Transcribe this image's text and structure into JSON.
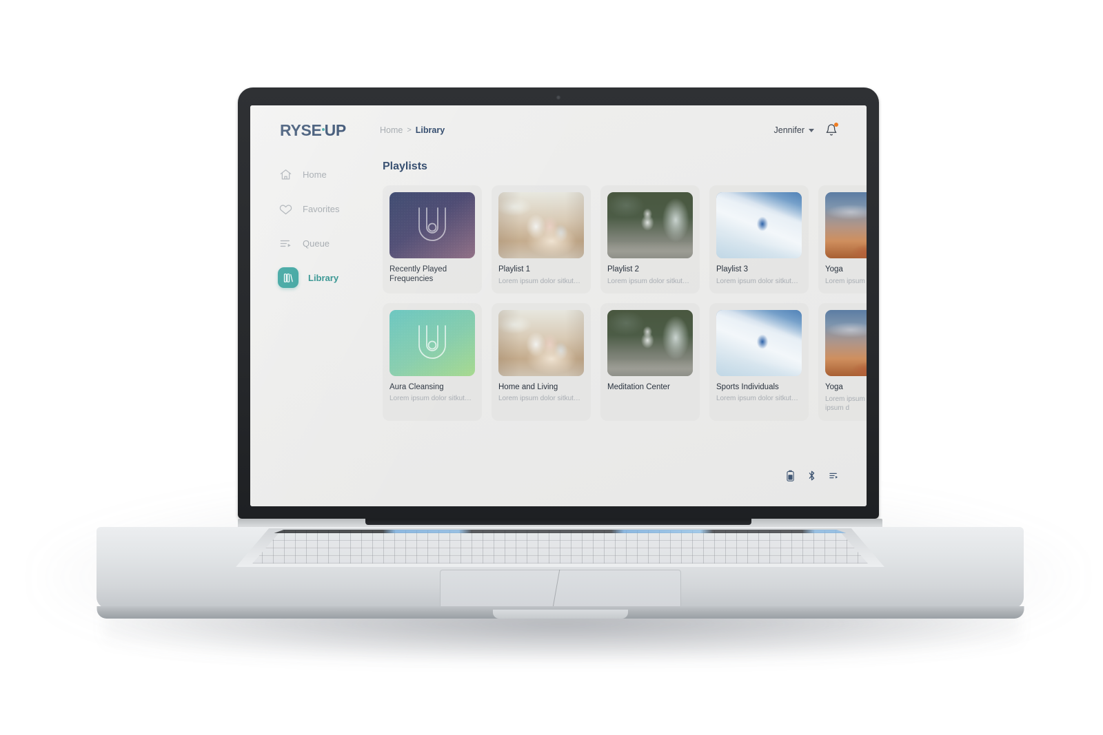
{
  "app": {
    "logo_text": "RYSEUP",
    "logo_primary": "RYSE",
    "logo_secondary": "UP",
    "accent_color": "#2b9c97",
    "brand_navy": "#1f3a5f",
    "badge_color": "#f07d22"
  },
  "breadcrumb": {
    "home": "Home",
    "separator": ">",
    "current": "Library"
  },
  "user": {
    "name": "Jennifer",
    "caret_icon": "chevron-down-icon",
    "bell_icon": "bell-icon",
    "has_notification": true
  },
  "sidebar": {
    "items": [
      {
        "label": "Home",
        "icon": "home-icon",
        "active": false
      },
      {
        "label": "Favorites",
        "icon": "heart-icon",
        "active": false
      },
      {
        "label": "Queue",
        "icon": "queue-icon",
        "active": false
      },
      {
        "label": "Library",
        "icon": "library-icon",
        "active": true
      }
    ]
  },
  "main": {
    "section_title": "Playlists",
    "row1": [
      {
        "title": "Recently Played Frequencies",
        "subtitle": "",
        "thumb": "brand-aurora"
      },
      {
        "title": "Playlist 1",
        "subtitle": "Lorem ipsum dolor sitkut…",
        "thumb": "photo-family"
      },
      {
        "title": "Playlist 2",
        "subtitle": "Lorem ipsum dolor sitkut…",
        "thumb": "photo-meditation"
      },
      {
        "title": "Playlist 3",
        "subtitle": "Lorem ipsum dolor sitkut…",
        "thumb": "photo-snow"
      },
      {
        "title": "Yoga",
        "subtitle": "Lorem ipsum dolo",
        "thumb": "photo-yoga"
      }
    ],
    "row2": [
      {
        "title": "Aura Cleansing",
        "subtitle": "Lorem ipsum dolor sitkut…",
        "thumb": "brand-mint"
      },
      {
        "title": "Home and Living",
        "subtitle": "Lorem ipsum dolor sitkut…",
        "thumb": "photo-family"
      },
      {
        "title": "Meditation Center",
        "subtitle": "",
        "thumb": "photo-meditation"
      },
      {
        "title": "Sports Individuals",
        "subtitle": "Lorem ipsum dolor sitkut…",
        "thumb": "photo-snow"
      },
      {
        "title": "Yoga",
        "subtitle": "Lorem ipsum dolo Lorem ipsum d",
        "thumb": "photo-yoga"
      }
    ]
  },
  "status_bar": {
    "icons": [
      {
        "name": "battery-icon"
      },
      {
        "name": "bluetooth-icon"
      },
      {
        "name": "queue-icon"
      }
    ]
  }
}
